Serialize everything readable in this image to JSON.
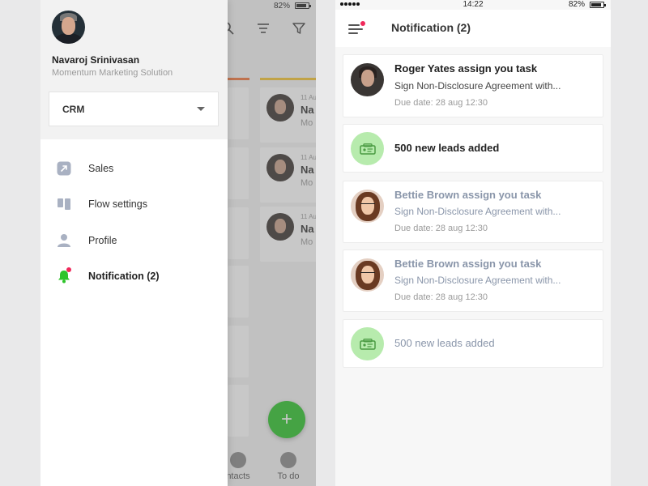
{
  "left_screen": {
    "status": {
      "battery": "82%"
    },
    "background_cards": [
      {
        "date": "11 Au",
        "name": "Na",
        "company": "Mo"
      },
      {
        "date": "11 Au",
        "name": "Na",
        "company": "Mo"
      },
      {
        "date": "11 Au",
        "name": "Na",
        "company": "Mo"
      }
    ],
    "background_tabs": [
      "ntacts",
      "To do"
    ],
    "fab_label": "+",
    "drawer": {
      "user_name": "Navaroj Srinivasan",
      "company": "Momentum Marketing Solution",
      "selector_value": "CRM",
      "menu": [
        {
          "label": "Sales",
          "icon": "arrow-square-icon",
          "active": false
        },
        {
          "label": "Flow settings",
          "icon": "columns-icon",
          "active": false
        },
        {
          "label": "Profile",
          "icon": "person-icon",
          "active": false
        },
        {
          "label": "Notification (2)",
          "icon": "bell-icon",
          "active": true,
          "badge": true
        }
      ]
    }
  },
  "right_screen": {
    "status": {
      "time": "14:22",
      "battery": "82%"
    },
    "title": "Notification (2)",
    "notifications": [
      {
        "type": "task",
        "title": "Roger Yates assign you task",
        "description": "Sign Non-Disclosure Agreement with...",
        "due": "Due date: 28 aug 12:30",
        "read": false
      },
      {
        "type": "leads",
        "title": "500 new leads added",
        "read": false
      },
      {
        "type": "task",
        "title": "Bettie Brown assign you task",
        "description": "Sign Non-Disclosure Agreement with...",
        "due": "Due date: 28 aug 12:30",
        "read": true
      },
      {
        "type": "task",
        "title": "Bettie Brown assign you task",
        "description": "Sign Non-Disclosure Agreement with...",
        "due": "Due date: 28 aug 12:30",
        "read": true
      },
      {
        "type": "leads",
        "title": "500 new leads added",
        "read": true
      }
    ]
  },
  "colors": {
    "accent_green": "#2dc42a",
    "badge_red": "#f0295b",
    "lead_icon_bg": "#b7ebad",
    "read_text": "#8a96aa",
    "column_stripe_orange": "#f0753a",
    "column_stripe_yellow": "#f4c430"
  }
}
